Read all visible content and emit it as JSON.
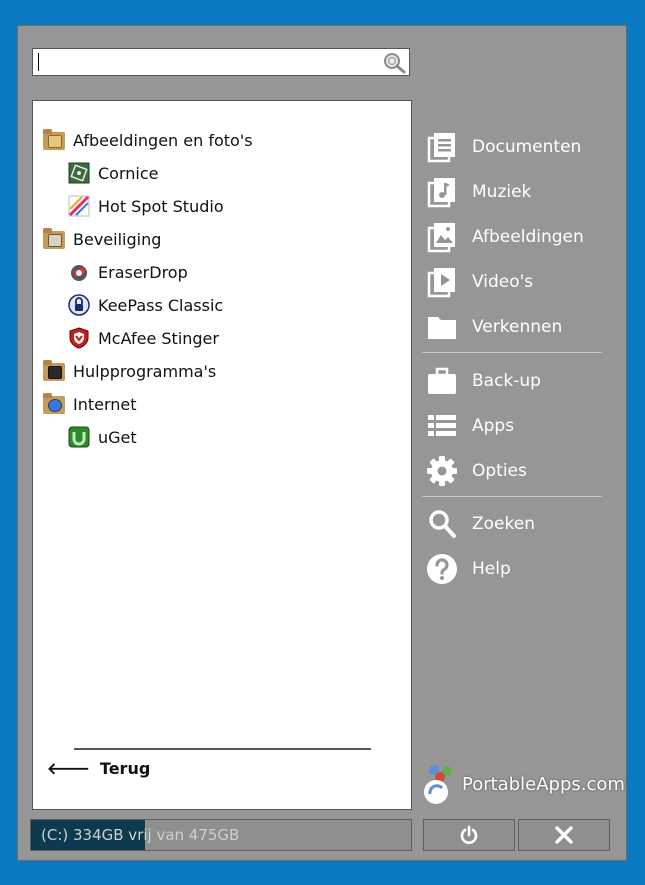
{
  "search": {
    "value": "",
    "placeholder": ""
  },
  "tree": {
    "categories": [
      {
        "label": "Afbeeldingen en foto's",
        "icon": "folder-pictures-icon",
        "apps": [
          {
            "label": "Cornice",
            "icon": "cornice-icon"
          },
          {
            "label": "Hot Spot Studio",
            "icon": "hotspot-studio-icon"
          }
        ]
      },
      {
        "label": "Beveiliging",
        "icon": "folder-security-icon",
        "apps": [
          {
            "label": "EraserDrop",
            "icon": "eraserdrop-icon"
          },
          {
            "label": "KeePass Classic",
            "icon": "keepass-icon"
          },
          {
            "label": "McAfee Stinger",
            "icon": "mcafee-icon"
          }
        ]
      },
      {
        "label": "Hulpprogramma's",
        "icon": "folder-utilities-icon",
        "apps": []
      },
      {
        "label": "Internet",
        "icon": "folder-internet-icon",
        "apps": [
          {
            "label": "uGet",
            "icon": "uget-icon"
          }
        ]
      }
    ],
    "back_label": "Terug"
  },
  "menu": {
    "group1": [
      {
        "label": "Documenten",
        "icon": "documents-icon"
      },
      {
        "label": "Muziek",
        "icon": "music-icon"
      },
      {
        "label": "Afbeeldingen",
        "icon": "pictures-icon"
      },
      {
        "label": "Video's",
        "icon": "videos-icon"
      },
      {
        "label": "Verkennen",
        "icon": "folder-icon"
      }
    ],
    "group2": [
      {
        "label": "Back-up",
        "icon": "briefcase-icon"
      },
      {
        "label": "Apps",
        "icon": "list-icon"
      },
      {
        "label": "Opties",
        "icon": "gear-icon"
      }
    ],
    "group3": [
      {
        "label": "Zoeken",
        "icon": "search-icon"
      },
      {
        "label": "Help",
        "icon": "help-icon"
      }
    ]
  },
  "status": {
    "text": "(C:) 334GB vrij van 475GB",
    "used_fraction": 0.3
  },
  "logo": {
    "text": "PortableApps.com"
  },
  "colors": {
    "background": "#0a7ac2",
    "panel": "#969696",
    "drive_bar": "#0e3a4f"
  }
}
